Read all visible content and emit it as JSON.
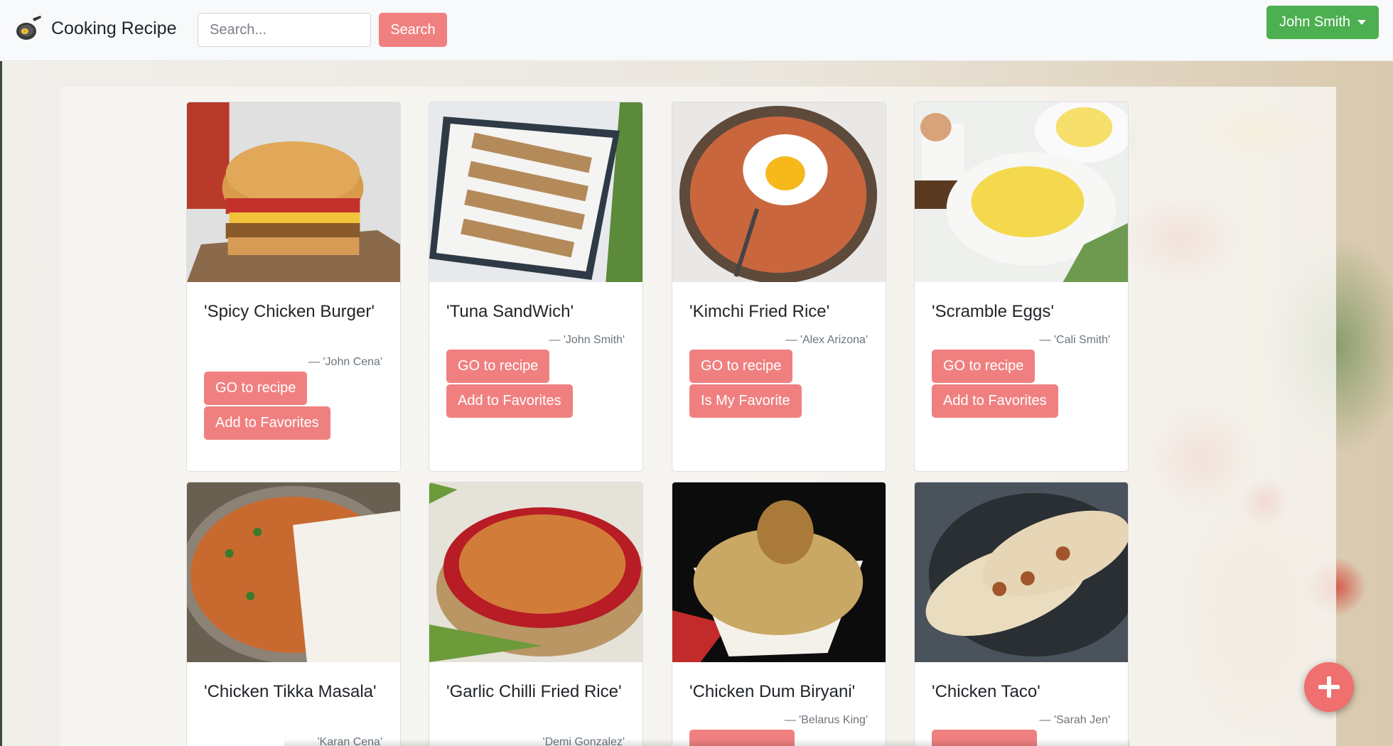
{
  "brand": {
    "title": "Cooking Recipe",
    "logo_icon": "frying-pan-icon"
  },
  "search": {
    "placeholder": "Search...",
    "button_label": "Search"
  },
  "user": {
    "name": "John Smith"
  },
  "colors": {
    "accent": "#f08080",
    "user_button": "#4caf50",
    "fab": "#f06f6f"
  },
  "recipes": [
    {
      "title": "'Spicy Chicken Burger'",
      "author": "— 'John Cena'",
      "go_label": "GO to recipe",
      "fav_label": "Add to Favorites"
    },
    {
      "title": "'Tuna SandWich'",
      "author": "— 'John Smith'",
      "go_label": "GO to recipe",
      "fav_label": "Add to Favorites"
    },
    {
      "title": "'Kimchi Fried Rice'",
      "author": "— 'Alex Arizona'",
      "go_label": "GO to recipe",
      "fav_label": "Is My Favorite"
    },
    {
      "title": "'Scramble Eggs'",
      "author": "— 'Cali Smith'",
      "go_label": "GO to recipe",
      "fav_label": "Add to Favorites"
    },
    {
      "title": "'Chicken Tikka Masala'",
      "author": "'Karan Cena'"
    },
    {
      "title": "'Garlic Chilli Fried Rice'",
      "author": "'Demi Gonzalez'"
    },
    {
      "title": "'Chicken Dum Biryani'",
      "author": "— 'Belarus King'"
    },
    {
      "title": "'Chicken Taco'",
      "author": "— 'Sarah Jen'"
    }
  ],
  "fab": {
    "icon": "plus-icon"
  }
}
